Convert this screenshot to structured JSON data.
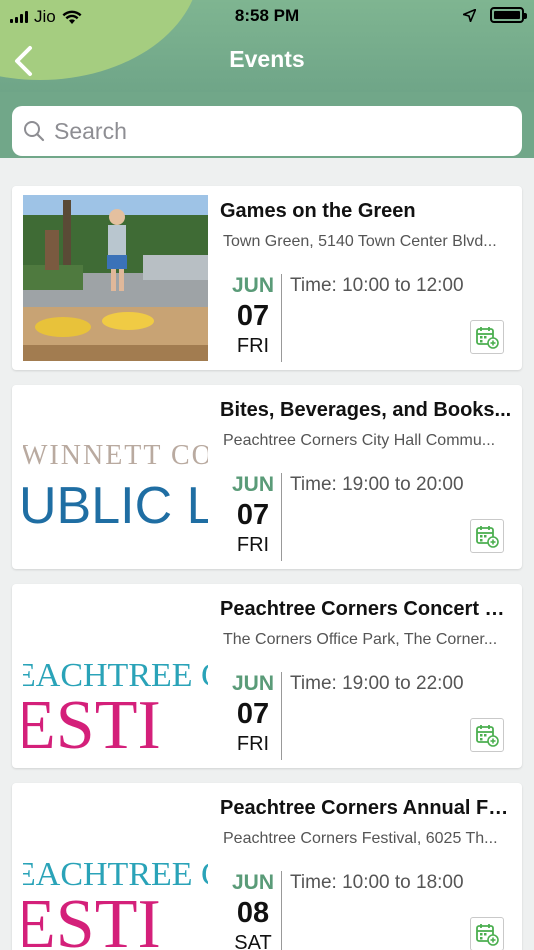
{
  "status_bar": {
    "carrier": "Jio",
    "time": "8:58 PM"
  },
  "nav": {
    "title": "Events"
  },
  "search": {
    "placeholder": "Search"
  },
  "events": [
    {
      "title": "Games on the Green",
      "location": "Town Green, 5140 Town Center Blvd...",
      "month": "JUN",
      "day": "07",
      "weekday": "FRI",
      "time": "Time: 10:00 to 12:00"
    },
    {
      "title": "Bites, Beverages, and Books...",
      "location": "Peachtree Corners City Hall Commu...",
      "month": "JUN",
      "day": "07",
      "weekday": "FRI",
      "time": "Time: 19:00 to 20:00",
      "logo_line1": "WINNETT CO",
      "logo_line2": "UBLIC L"
    },
    {
      "title": "Peachtree Corners Concert &...",
      "location": "The Corners Office Park, The Corner...",
      "month": "JUN",
      "day": "07",
      "weekday": "FRI",
      "time": "Time: 19:00 to 22:00",
      "logo_line1": "EACHTREE C",
      "logo_line2": "ESTI"
    },
    {
      "title": "Peachtree Corners Annual Fes...",
      "location": "Peachtree Corners Festival, 6025 Th...",
      "month": "JUN",
      "day": "08",
      "weekday": "SAT",
      "time": "Time: 10:00 to 18:00",
      "logo_line1": "EACHTREE C",
      "logo_line2": "ESTI"
    }
  ],
  "colors": {
    "accent": "#5a9b78",
    "header": "#71a789",
    "header_blob": "#a8cf7f",
    "calendar_icon": "#4caf50"
  }
}
